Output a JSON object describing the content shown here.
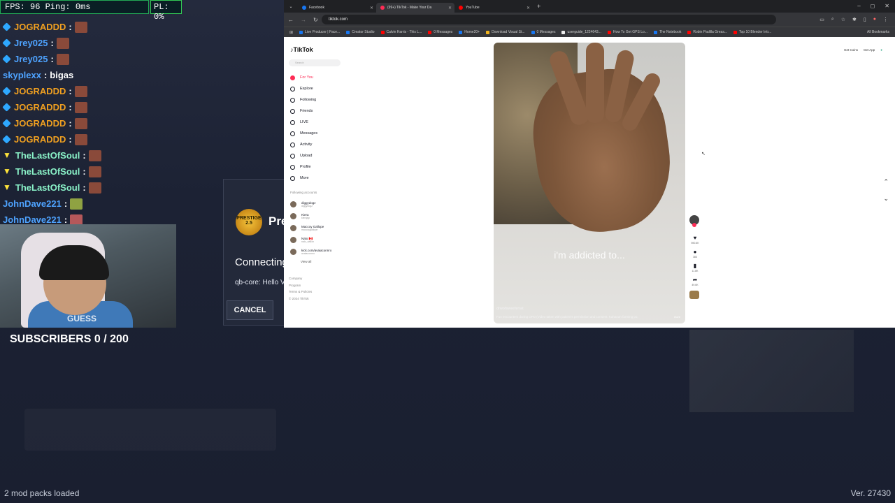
{
  "stats": {
    "ping": "FPS: 96  Ping: 0ms",
    "packet_loss": "PL: 0%"
  },
  "chat": [
    {
      "user": "JOGRADDD",
      "color": "#f0a020",
      "badge": "cube",
      "emote": "face",
      "msg": ""
    },
    {
      "user": "Jrey025",
      "color": "#4ea3ff",
      "badge": "cube",
      "emote": "face",
      "msg": ""
    },
    {
      "user": "Jrey025",
      "color": "#4ea3ff",
      "badge": "cube",
      "emote": "face",
      "msg": ""
    },
    {
      "user": "skyplexx",
      "color": "#4ea3ff",
      "badge": "",
      "emote": "",
      "msg": "bigas"
    },
    {
      "user": "JOGRADDD",
      "color": "#f0a020",
      "badge": "cube",
      "emote": "face",
      "msg": ""
    },
    {
      "user": "JOGRADDD",
      "color": "#f0a020",
      "badge": "cube",
      "emote": "face",
      "msg": ""
    },
    {
      "user": "JOGRADDD",
      "color": "#f0a020",
      "badge": "cube",
      "emote": "face",
      "msg": ""
    },
    {
      "user": "JOGRADDD",
      "color": "#f0a020",
      "badge": "cube",
      "emote": "face",
      "msg": ""
    },
    {
      "user": "TheLastOfSoul",
      "color": "#8af2c8",
      "badge": "p",
      "emote": "face",
      "msg": ""
    },
    {
      "user": "TheLastOfSoul",
      "color": "#8af2c8",
      "badge": "p",
      "emote": "face",
      "msg": ""
    },
    {
      "user": "TheLastOfSoul",
      "color": "#8af2c8",
      "badge": "p",
      "emote": "face",
      "msg": ""
    },
    {
      "user": "JohnDave221",
      "color": "#4ea3ff",
      "badge": "",
      "emote": "green",
      "msg": ""
    },
    {
      "user": "JohnDave221",
      "color": "#4ea3ff",
      "badge": "",
      "emote": "car",
      "msg": ""
    }
  ],
  "chat_sep": ":",
  "webcam": {
    "shirt_text": "GUESS"
  },
  "subscribers": "SUBSCRIBERS 0 / 200",
  "footer": {
    "mods": "2 mod packs loaded",
    "version": "Ver. 27430"
  },
  "dialog": {
    "logo_text": "PRESTIGE 2.5",
    "title": "Pre",
    "connecting": "Connecting",
    "hello": "qb-core: Hello V",
    "cancel": "CANCEL"
  },
  "browser": {
    "tabs": [
      {
        "label": "Facebook",
        "color": "#1877f2",
        "active": false
      },
      {
        "label": "(99+) TikTok - Make Your Da",
        "color": "#fe2c55",
        "active": true
      },
      {
        "label": "YouTube",
        "color": "#ff0000",
        "active": false
      }
    ],
    "url": "tiktok.com",
    "bookmarks": [
      {
        "label": "Live Producer | Face...",
        "color": "#1877f2"
      },
      {
        "label": "Creator Studio",
        "color": "#1877f2"
      },
      {
        "label": "Calvin Harris - This L...",
        "color": "#ff0000"
      },
      {
        "label": "0 Messages",
        "color": "#ff0000"
      },
      {
        "label": "Home20+",
        "color": "#1877f2"
      },
      {
        "label": "Download Visual St...",
        "color": "#f1b31c"
      },
      {
        "label": "0 Messages",
        "color": "#1877f2"
      },
      {
        "label": "userguide_1224643...",
        "color": "#eee"
      },
      {
        "label": "How To Get GPS Lo...",
        "color": "#ff0000"
      },
      {
        "label": "The Notebook",
        "color": "#1877f2"
      },
      {
        "label": "Robin Padilla Greas...",
        "color": "#ff0000"
      },
      {
        "label": "Top 10 Blender Intr...",
        "color": "#ff0000"
      }
    ],
    "all_bookmarks": "All Bookmarks"
  },
  "tiktok": {
    "logo": "TikTok",
    "search_placeholder": "Search",
    "nav": [
      {
        "label": "For You",
        "active": true,
        "icon": "home-icon"
      },
      {
        "label": "Explore",
        "active": false,
        "icon": "compass-icon"
      },
      {
        "label": "Following",
        "active": false,
        "icon": "following-icon"
      },
      {
        "label": "Friends",
        "active": false,
        "icon": "friends-icon"
      },
      {
        "label": "LIVE",
        "active": false,
        "icon": "live-icon"
      },
      {
        "label": "Messages",
        "active": false,
        "icon": "messages-icon"
      },
      {
        "label": "Activity",
        "active": false,
        "icon": "activity-icon"
      },
      {
        "label": "Upload",
        "active": false,
        "icon": "upload-icon"
      },
      {
        "label": "Profile",
        "active": false,
        "icon": "profile-icon"
      },
      {
        "label": "More",
        "active": false,
        "icon": "more-icon"
      }
    ],
    "following_header": "Following accounts",
    "accounts": [
      {
        "name": "diggydogz",
        "sub": "diggydogz"
      },
      {
        "name": "Kiera",
        "sub": "kierajsp"
      },
      {
        "name": "Maccoy Gallope",
        "sub": "maccoygallope"
      },
      {
        "name": "Nalo 🇨🇦",
        "sub": "nalo_nation"
      },
      {
        "name": "kick.com/avaiaconnro",
        "sub": "avaiaconnro"
      }
    ],
    "view_all": "View all",
    "footer": [
      "Company",
      "Program",
      "Terms & Policies",
      "© 2024 TikTok"
    ],
    "get_coins": "Get Coins",
    "get_app": "Get App",
    "video": {
      "caption": "i'm addicted to...",
      "author": "drwofsweeferrat",
      "desc": "Fun encounters during OPD (Video taken with patient's permission and consent. Kahanan farming po,",
      "more": "more"
    },
    "actions": [
      {
        "icon": "heart-icon",
        "glyph": "♥",
        "count": "590.6K"
      },
      {
        "icon": "comment-icon",
        "glyph": "●",
        "count": "383"
      },
      {
        "icon": "bookmark-icon",
        "glyph": "▮",
        "count": "11.8K"
      },
      {
        "icon": "share-icon",
        "glyph": "➦",
        "count": "49.6K"
      }
    ]
  }
}
